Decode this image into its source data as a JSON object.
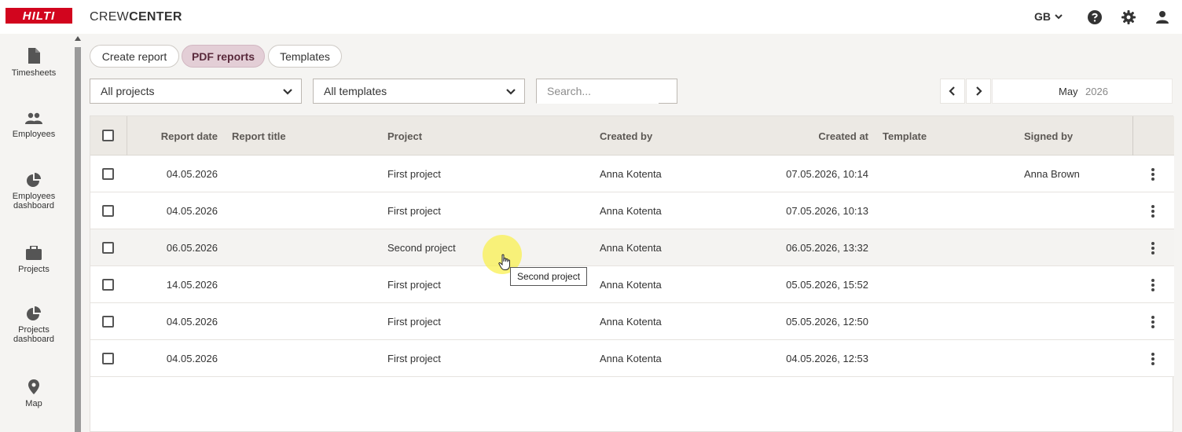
{
  "header": {
    "logo_text": "HILTI",
    "brand_light": "CREW",
    "brand_bold": "CENTER",
    "language": "GB"
  },
  "sidebar": {
    "items": [
      {
        "label": "Timesheets",
        "icon": "document-icon"
      },
      {
        "label": "Employees",
        "icon": "people-icon"
      },
      {
        "label": "Employees dashboard",
        "icon": "pie-chart-icon"
      },
      {
        "label": "Projects",
        "icon": "briefcase-icon"
      },
      {
        "label": "Projects dashboard",
        "icon": "pie-chart-icon"
      },
      {
        "label": "Map",
        "icon": "map-pin-icon"
      }
    ]
  },
  "tabs": [
    {
      "label": "Create report",
      "active": false
    },
    {
      "label": "PDF reports",
      "active": true
    },
    {
      "label": "Templates",
      "active": false
    }
  ],
  "filters": {
    "projects_value": "All projects",
    "templates_value": "All templates",
    "search_placeholder": "Search..."
  },
  "date_nav": {
    "month": "May",
    "year": "2026"
  },
  "table": {
    "columns": {
      "report_date": "Report date",
      "report_title": "Report title",
      "project": "Project",
      "created_by": "Created by",
      "created_at": "Created at",
      "template": "Template",
      "signed_by": "Signed by"
    },
    "rows": [
      {
        "report_date": "04.05.2026",
        "report_title": "",
        "project": "First project",
        "created_by": "Anna Kotenta",
        "created_at": "07.05.2026, 10:14",
        "template": "",
        "signed_by": "Anna Brown"
      },
      {
        "report_date": "04.05.2026",
        "report_title": "",
        "project": "First project",
        "created_by": "Anna Kotenta",
        "created_at": "07.05.2026, 10:13",
        "template": "",
        "signed_by": ""
      },
      {
        "report_date": "06.05.2026",
        "report_title": "",
        "project": "Second project",
        "created_by": "Anna Kotenta",
        "created_at": "06.05.2026, 13:32",
        "template": "",
        "signed_by": ""
      },
      {
        "report_date": "14.05.2026",
        "report_title": "",
        "project": "First project",
        "created_by": "Anna Kotenta",
        "created_at": "05.05.2026, 15:52",
        "template": "",
        "signed_by": ""
      },
      {
        "report_date": "04.05.2026",
        "report_title": "",
        "project": "First project",
        "created_by": "Anna Kotenta",
        "created_at": "05.05.2026, 12:50",
        "template": "",
        "signed_by": ""
      },
      {
        "report_date": "04.05.2026",
        "report_title": "",
        "project": "First project",
        "created_by": "Anna Kotenta",
        "created_at": "04.05.2026, 12:53",
        "template": "",
        "signed_by": ""
      }
    ]
  },
  "tooltip": "Second project",
  "colors": {
    "brand_red": "#d2051e",
    "active_tab_bg": "#e3ced6",
    "table_header_bg": "#ece9e4",
    "cursor_highlight": "#f6ea50"
  }
}
